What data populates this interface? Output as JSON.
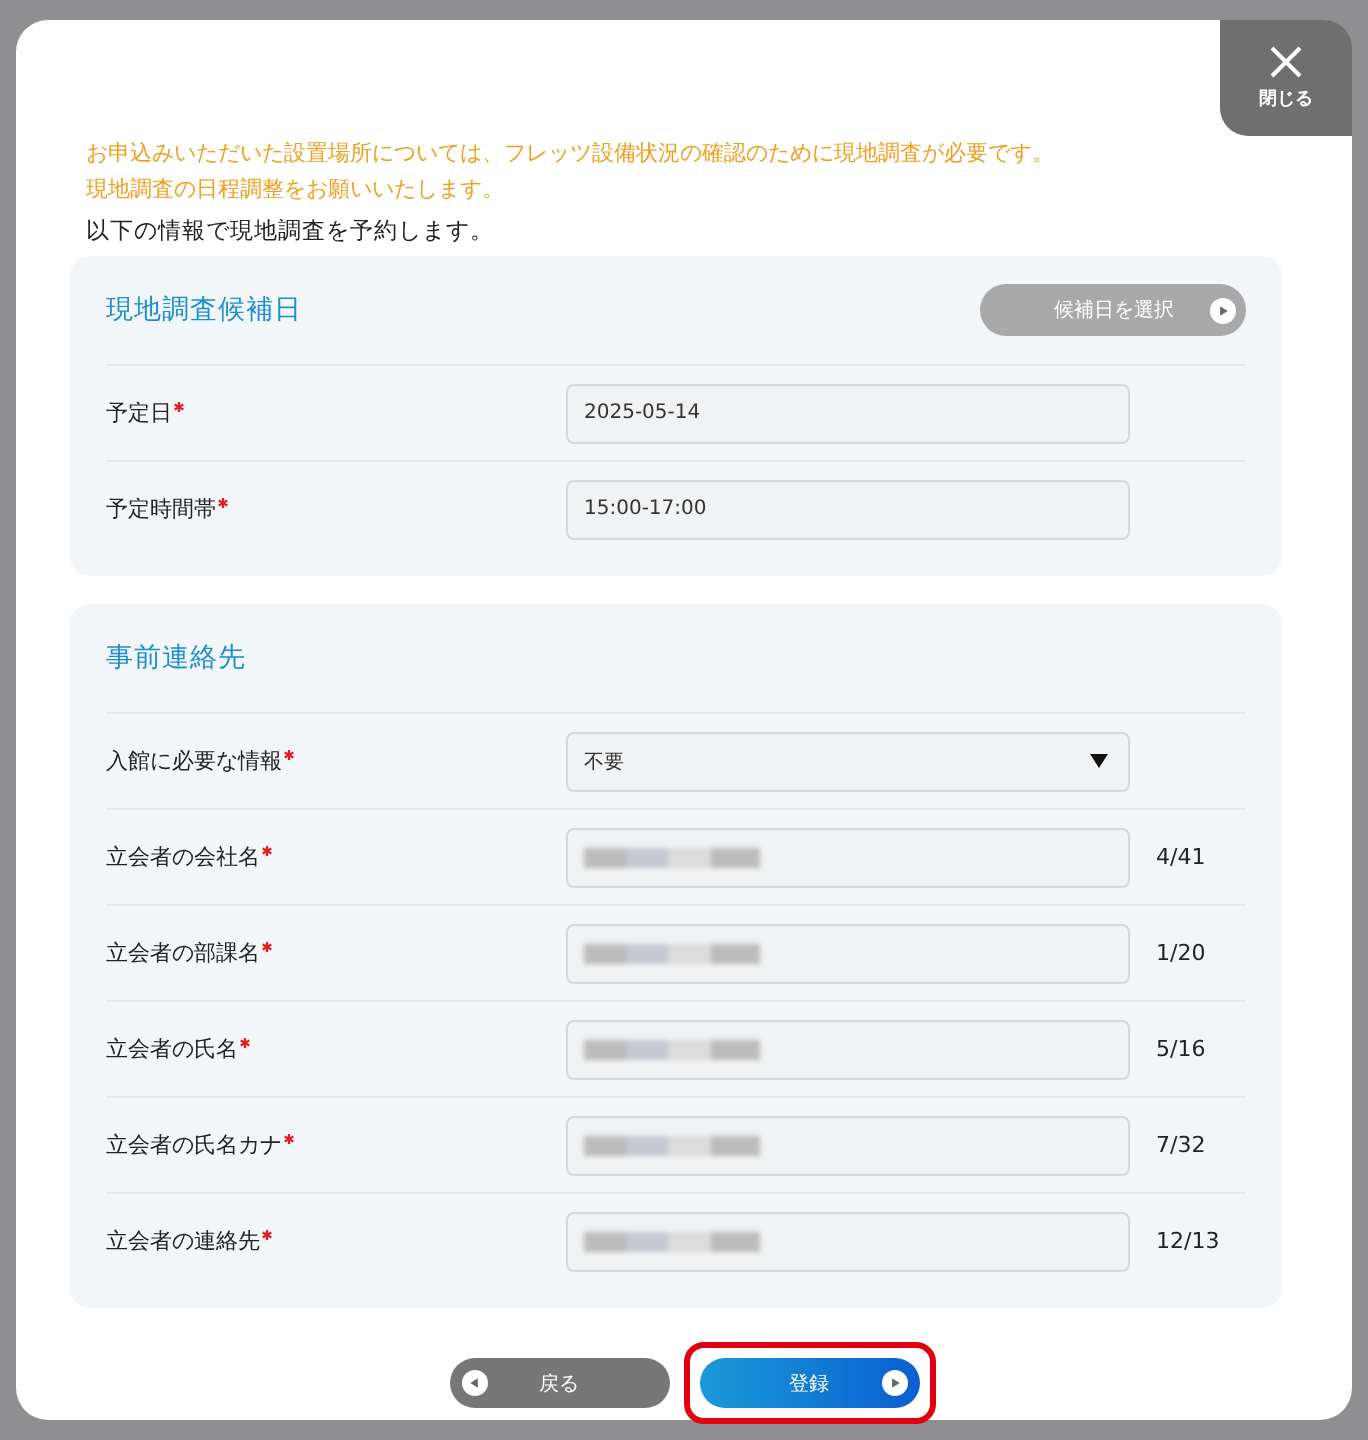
{
  "close_button": {
    "label": "閉じる"
  },
  "notice": [
    "お申込みいただいた設置場所については、フレッツ設備状況の確認のために現地調査が必要です。",
    "現地調査の日程調整をお願いいたします。"
  ],
  "intro": "以下の情報で現地調査を予約します。",
  "sections": [
    {
      "title": "現地調査候補日",
      "action": {
        "label": "候補日を選択",
        "disabled": true
      },
      "rows": [
        {
          "label": "予定日",
          "required": true,
          "kind": "text",
          "value": "2025-05-14"
        },
        {
          "label": "予定時間帯",
          "required": true,
          "kind": "text",
          "value": "15:00-17:00"
        }
      ]
    },
    {
      "title": "事前連絡先",
      "rows": [
        {
          "label": "入館に必要な情報",
          "required": true,
          "kind": "select",
          "value": "不要"
        },
        {
          "label": "立会者の会社名",
          "required": true,
          "kind": "redacted",
          "counter": "4/41"
        },
        {
          "label": "立会者の部課名",
          "required": true,
          "kind": "redacted",
          "counter": "1/20"
        },
        {
          "label": "立会者の氏名",
          "required": true,
          "kind": "redacted",
          "counter": "5/16"
        },
        {
          "label": "立会者の氏名カナ",
          "required": true,
          "kind": "redacted",
          "counter": "7/32"
        },
        {
          "label": "立会者の連絡先",
          "required": true,
          "kind": "redacted",
          "counter": "12/13"
        }
      ]
    }
  ],
  "buttons": [
    {
      "label": "戻る",
      "kind": "back",
      "highlighted": false
    },
    {
      "label": "登録",
      "kind": "submit",
      "highlighted": true
    }
  ]
}
